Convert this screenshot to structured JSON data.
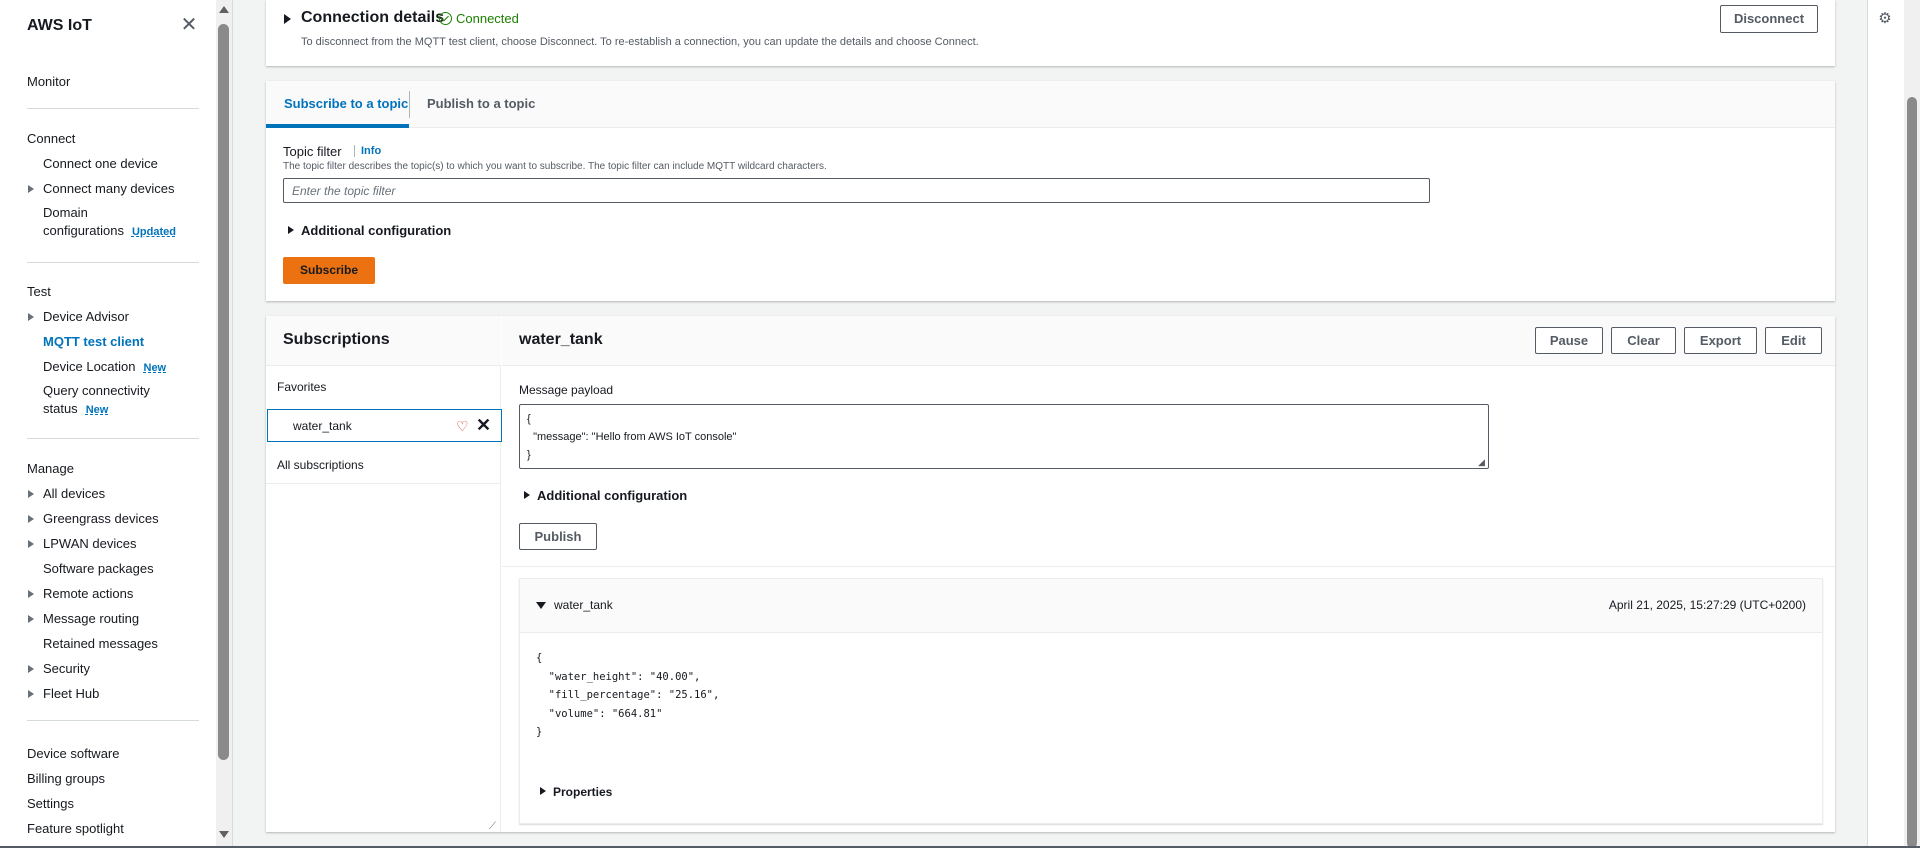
{
  "sidebar": {
    "brand": "AWS IoT",
    "monitor": "Monitor",
    "connect": {
      "heading": "Connect",
      "connect_one": "Connect one device",
      "connect_many": "Connect many devices",
      "domain_line1": "Domain",
      "domain_line2": "configurations",
      "domain_badge": "Updated"
    },
    "test": {
      "heading": "Test",
      "device_advisor": "Device Advisor",
      "mqtt_client": "MQTT test client",
      "device_location": "Device Location",
      "device_location_badge": "New",
      "query_line1": "Query connectivity",
      "query_line2": "status",
      "query_badge": "New"
    },
    "manage": {
      "heading": "Manage",
      "all_devices": "All devices",
      "greengrass": "Greengrass devices",
      "lpwan": "LPWAN devices",
      "software_packages": "Software packages",
      "remote_actions": "Remote actions",
      "message_routing": "Message routing",
      "retained_messages": "Retained messages",
      "security": "Security",
      "fleet_hub": "Fleet Hub"
    },
    "footer": {
      "device_software": "Device software",
      "billing_groups": "Billing groups",
      "settings": "Settings",
      "feature_spotlight": "Feature spotlight"
    }
  },
  "connection": {
    "title": "Connection details",
    "status": "Connected",
    "description": "To disconnect from the MQTT test client, choose Disconnect. To re-establish a connection, you can update the details and choose Connect.",
    "disconnect_label": "Disconnect"
  },
  "subscribe_panel": {
    "tabs": [
      "Subscribe to a topic",
      "Publish to a topic"
    ],
    "topic_filter_label": "Topic filter",
    "info_label": "Info",
    "topic_filter_desc": "The topic filter describes the topic(s) to which you want to subscribe. The topic filter can include MQTT wildcard characters.",
    "topic_filter_placeholder": "Enter the topic filter",
    "topic_filter_value": "",
    "additional_config": "Additional configuration",
    "subscribe_label": "Subscribe"
  },
  "subscriptions": {
    "title": "Subscriptions",
    "favorites_label": "Favorites",
    "items": [
      {
        "name": "water_tank"
      }
    ],
    "all_label": "All subscriptions"
  },
  "messages": {
    "topic": "water_tank",
    "buttons": {
      "pause": "Pause",
      "clear": "Clear",
      "export": "Export",
      "edit": "Edit"
    },
    "payload_label": "Message payload",
    "payload_value": "{\n  \"message\": \"Hello from AWS IoT console\"\n}",
    "additional_config": "Additional configuration",
    "publish_label": "Publish",
    "received": [
      {
        "topic": "water_tank",
        "timestamp": "April 21, 2025, 15:27:29 (UTC+0200)",
        "body": "{\n  \"water_height\": \"40.00\",\n  \"fill_percentage\": \"25.16\",\n  \"volume\": \"664.81\"\n}",
        "properties_label": "Properties"
      }
    ]
  },
  "colors": {
    "accent": "#0073bb",
    "primary_button": "#ec7211",
    "success": "#1d8102",
    "favorite": "#d13212"
  },
  "icons": [
    "close-icon",
    "check-circle-icon",
    "heart-icon",
    "remove-icon",
    "settings-icon",
    "caret-right-icon",
    "caret-down-icon"
  ]
}
